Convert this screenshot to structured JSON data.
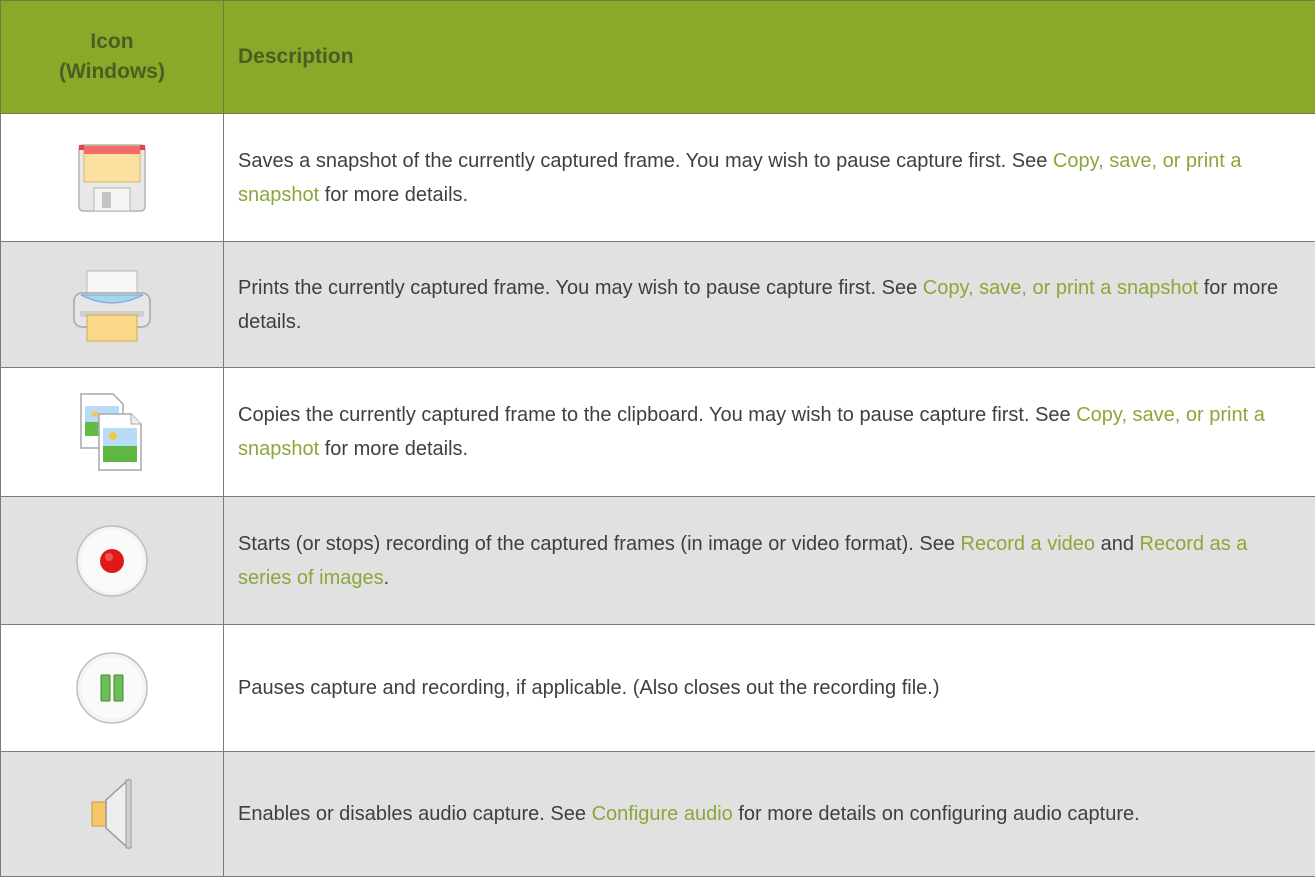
{
  "table": {
    "headers": {
      "icon_line1": "Icon",
      "icon_line2": "(Windows)",
      "description": "Description"
    },
    "rows": [
      {
        "icon": "save-icon",
        "text_before": "Saves a snapshot of the currently captured frame. You may wish to pause capture first. See ",
        "link1": "Copy, save, or print a snapshot",
        "text_mid": "",
        "link2": "",
        "text_after": " for more details."
      },
      {
        "icon": "printer-icon",
        "text_before": "Prints the currently captured frame. You may wish to pause capture first. See ",
        "link1": "Copy, save, or print a snapshot",
        "text_mid": "",
        "link2": "",
        "text_after": " for more details."
      },
      {
        "icon": "copy-icon",
        "text_before": "Copies the currently captured frame to the clipboard. You may wish to pause capture first. See ",
        "link1": "Copy, save, or print a snapshot",
        "text_mid": "",
        "link2": "",
        "text_after": " for more details."
      },
      {
        "icon": "record-icon",
        "text_before": "Starts (or stops) recording of the captured frames (in image or video format). See ",
        "link1": "Record a video",
        "text_mid": " and ",
        "link2": "Record as a series of images",
        "text_after": "."
      },
      {
        "icon": "pause-icon",
        "text_before": "Pauses capture and recording, if applicable. (Also closes out the recording file.)",
        "link1": "",
        "text_mid": "",
        "link2": "",
        "text_after": ""
      },
      {
        "icon": "speaker-icon",
        "text_before": "Enables or disables audio capture. See ",
        "link1": "Configure audio",
        "text_mid": "",
        "link2": "",
        "text_after": " for more details on configuring audio capture."
      }
    ]
  },
  "colors": {
    "header_bg": "#8ba828",
    "header_text": "#4a5e24",
    "link": "#8aa83a",
    "stripe": "#e1e1e1"
  }
}
